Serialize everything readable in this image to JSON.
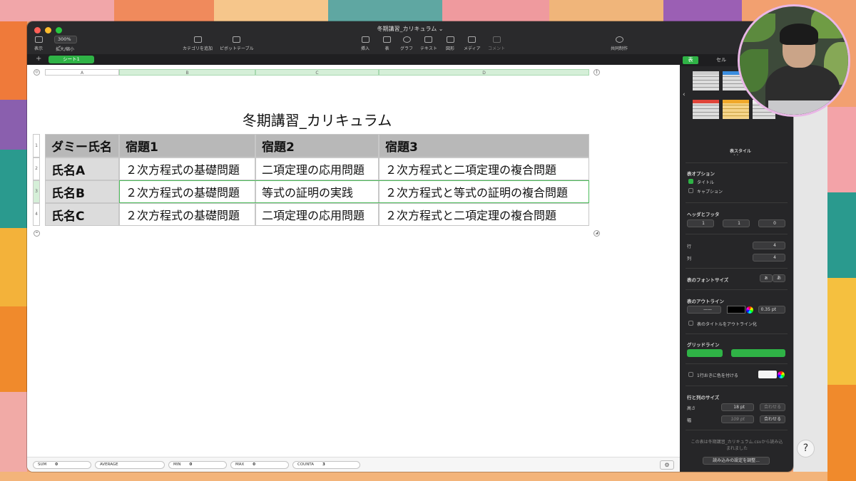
{
  "window": {
    "title": "冬期講習_カリキュラム",
    "title_suffix": "⌄"
  },
  "toolbar": {
    "view_label": "表示",
    "zoom_value": "300%",
    "zoom_label": "拡大/縮小",
    "add_category_label": "カテゴリを追加",
    "pivot_label": "ピボットテーブル",
    "insert_label": "挿入",
    "table_label": "表",
    "chart_label": "グラフ",
    "text_label": "テキスト",
    "shape_label": "図形",
    "media_label": "メディア",
    "comment_label": "コメント",
    "collab_label": "共同制作"
  },
  "sheets": {
    "add": "+",
    "active_tab": "シート1"
  },
  "columns": [
    "A",
    "B",
    "C",
    "D"
  ],
  "rows": [
    "1",
    "2",
    "3",
    "4"
  ],
  "table": {
    "title": "冬期講習_カリキュラム",
    "header": [
      "ダミー氏名",
      "宿題1",
      "宿題2",
      "宿題3"
    ],
    "body": [
      [
        "氏名A",
        "２次方程式の基礎問題",
        "二項定理の応用問題",
        "２次方程式と二項定理の複合問題"
      ],
      [
        "氏名B",
        "２次方程式の基礎問題",
        "等式の証明の実践",
        "２次方程式と等式の証明の複合問題"
      ],
      [
        "氏名C",
        "２次方程式の基礎問題",
        "二項定理の応用問題",
        "２次方程式と二項定理の複合問題"
      ]
    ]
  },
  "status": {
    "sum_label": "SUM",
    "sum_value": "0",
    "avg_label": "AVERAGE",
    "avg_value": "",
    "min_label": "MIN",
    "min_value": "0",
    "max_label": "MAX",
    "max_value": "0",
    "counta_label": "COUNTA",
    "counta_value": "3",
    "gear": "⚙"
  },
  "inspector": {
    "tab_table": "表",
    "tab_cell": "セル",
    "style_label": "表スタイル",
    "options_title": "表オプション",
    "opt_title": "タイトル",
    "opt_caption": "キャプション",
    "header_footer_title": "ヘッダとフッタ",
    "hf_header_rows": "1",
    "hf_header_cols": "1",
    "hf_footer_rows": "0",
    "rows_label": "行",
    "rows_value": "4",
    "cols_label": "列",
    "cols_value": "4",
    "font_size_label": "表のフォントサイズ",
    "font_small": "ぁ",
    "font_large": "あ",
    "outline_title": "表のアウトライン",
    "outline_width": "0.35 pt",
    "outline_title_opt": "表のタイトルをアウトライン化",
    "gridlines_title": "グリッドライン",
    "alt_rows_label": "1行おきに色を付ける",
    "rowcol_size_title": "行と列のサイズ",
    "height_label": "高さ",
    "height_value": "18 pt",
    "width_label": "幅",
    "width_value": "109 pt",
    "fit_label": "合わせる",
    "import_note": "この表は冬期講習_カリキュラム.csvから読み込まれました",
    "import_button": "読み込みの設定を調整..."
  },
  "help": "?",
  "colors": {
    "accent": "#2fb346",
    "header_fill": "#b8b8b8",
    "row_header_fill": "#dcdcdc"
  }
}
